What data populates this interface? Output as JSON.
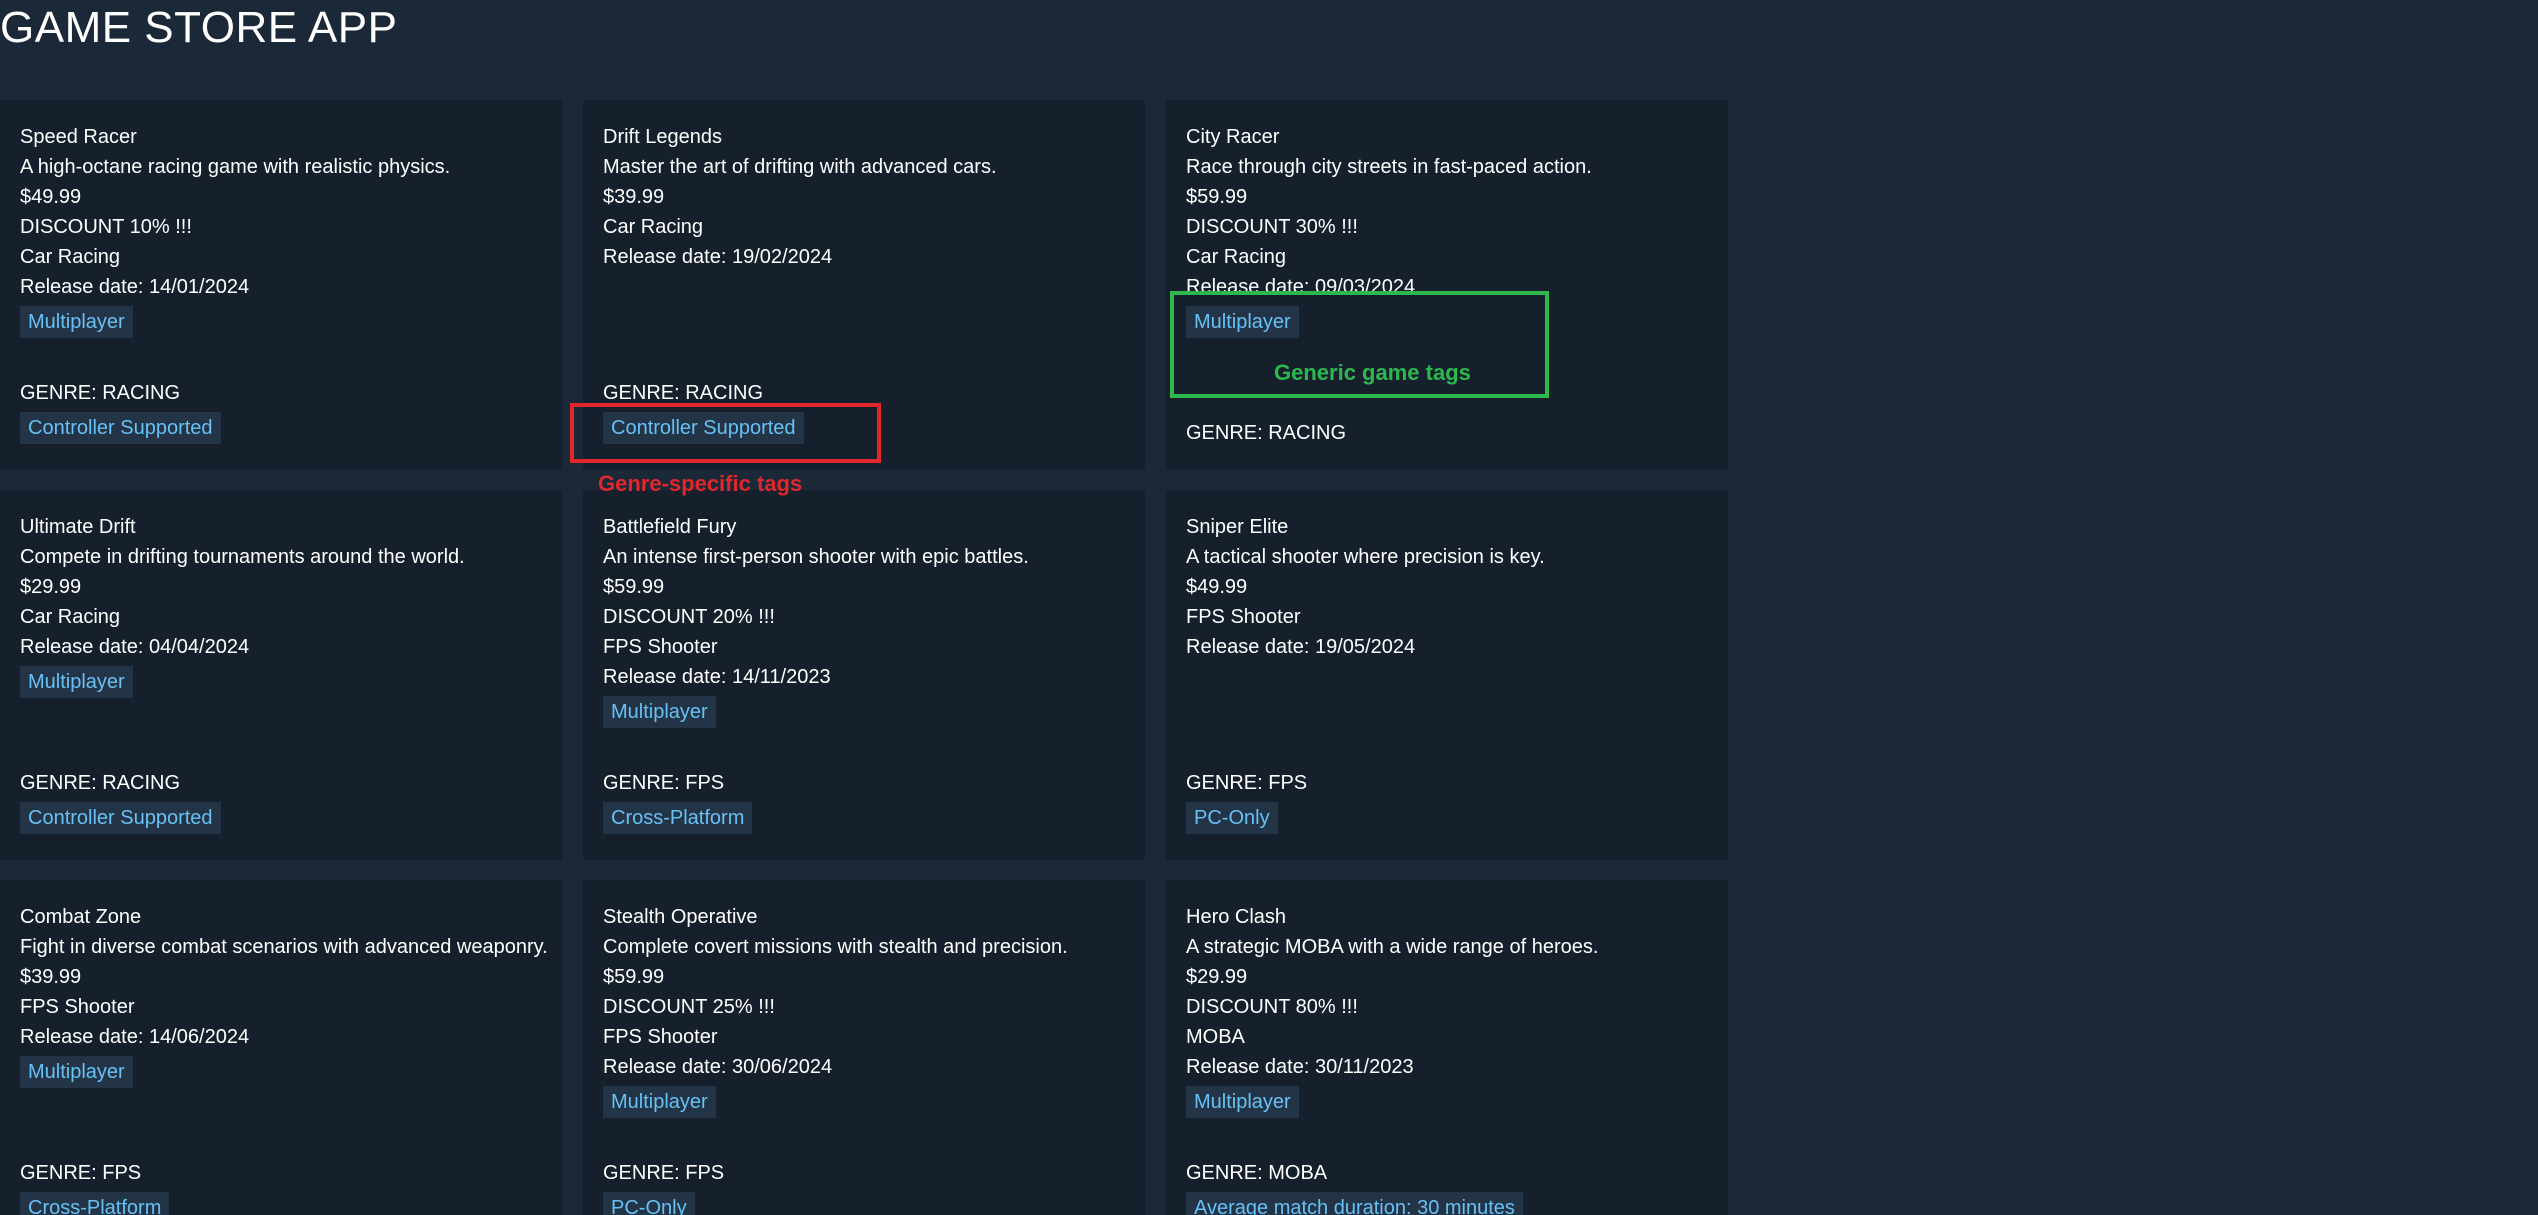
{
  "app": {
    "title": "GAME STORE APP"
  },
  "games": [
    {
      "name": "Speed Racer",
      "description": "A high-octane racing game with realistic physics.",
      "price": "$49.99",
      "discount": "DISCOUNT 10% !!!",
      "category": "Car Racing",
      "release": "Release date: 14/01/2024",
      "tag": "Multiplayer",
      "genre": "GENRE: RACING",
      "genre_tag": "Controller Supported"
    },
    {
      "name": "Drift Legends",
      "description": "Master the art of drifting with advanced cars.",
      "price": "$39.99",
      "discount": "",
      "category": "Car Racing",
      "release": "Release date: 19/02/2024",
      "tag": "",
      "genre": "GENRE: RACING",
      "genre_tag": "Controller Supported"
    },
    {
      "name": "City Racer",
      "description": "Race through city streets in fast-paced action.",
      "price": "$59.99",
      "discount": "DISCOUNT 30% !!!",
      "category": "Car Racing",
      "release": "Release date: 09/03/2024",
      "tag": "Multiplayer",
      "genre": "GENRE: RACING",
      "genre_tag": ""
    },
    {
      "name": "Ultimate Drift",
      "description": "Compete in drifting tournaments around the world.",
      "price": "$29.99",
      "discount": "",
      "category": "Car Racing",
      "release": "Release date: 04/04/2024",
      "tag": "Multiplayer",
      "genre": "GENRE: RACING",
      "genre_tag": "Controller Supported"
    },
    {
      "name": "Battlefield Fury",
      "description": "An intense first-person shooter with epic battles.",
      "price": "$59.99",
      "discount": "DISCOUNT 20% !!!",
      "category": "FPS Shooter",
      "release": "Release date: 14/11/2023",
      "tag": "Multiplayer",
      "genre": "GENRE: FPS",
      "genre_tag": "Cross-Platform"
    },
    {
      "name": "Sniper Elite",
      "description": "A tactical shooter where precision is key.",
      "price": "$49.99",
      "discount": "",
      "category": "FPS Shooter",
      "release": "Release date: 19/05/2024",
      "tag": "",
      "genre": "GENRE: FPS",
      "genre_tag": "PC-Only"
    },
    {
      "name": "Combat Zone",
      "description": "Fight in diverse combat scenarios with advanced weaponry.",
      "price": "$39.99",
      "discount": "",
      "category": "FPS Shooter",
      "release": "Release date: 14/06/2024",
      "tag": "Multiplayer",
      "genre": "GENRE: FPS",
      "genre_tag": "Cross-Platform"
    },
    {
      "name": "Stealth Operative",
      "description": "Complete covert missions with stealth and precision.",
      "price": "$59.99",
      "discount": "DISCOUNT 25% !!!",
      "category": "FPS Shooter",
      "release": "Release date: 30/06/2024",
      "tag": "Multiplayer",
      "genre": "GENRE: FPS",
      "genre_tag": "PC-Only"
    },
    {
      "name": "Hero Clash",
      "description": "A strategic MOBA with a wide range of heroes.",
      "price": "$29.99",
      "discount": "DISCOUNT 80% !!!",
      "category": "MOBA",
      "release": "Release date: 30/11/2023",
      "tag": "Multiplayer",
      "genre": "GENRE: MOBA",
      "genre_tag": "Average match duration: 30 minutes"
    }
  ],
  "annotations": {
    "genre_specific": "Genre-specific tags",
    "generic": "Generic game tags"
  },
  "colors": {
    "background": "#1b2838",
    "card": "#16202d",
    "tag_bg": "#233447",
    "tag_text": "#67c1f5",
    "annotation_red": "#e1262c",
    "annotation_green": "#2db84d"
  }
}
